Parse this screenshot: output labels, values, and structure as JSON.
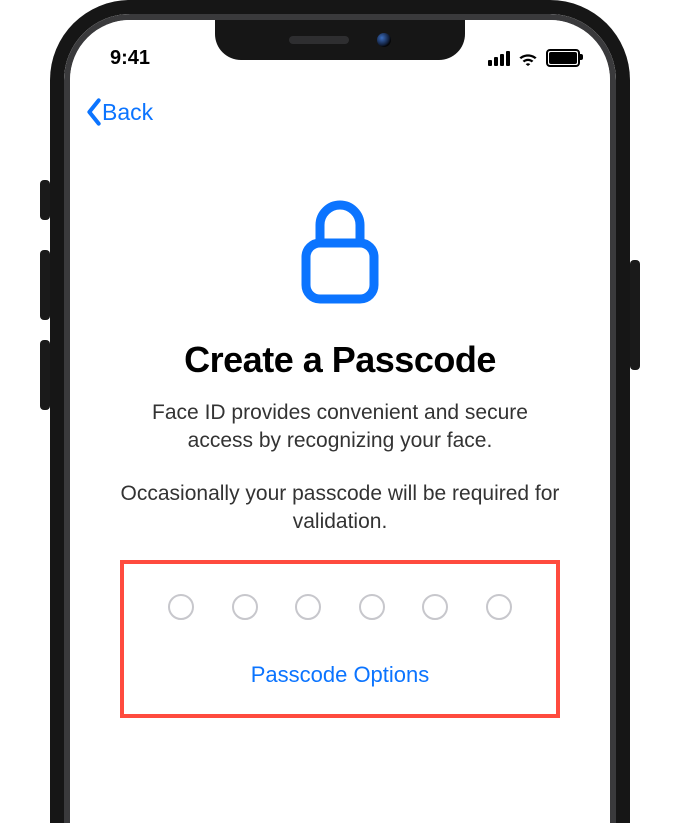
{
  "status": {
    "time": "9:41"
  },
  "nav": {
    "back_label": "Back"
  },
  "page": {
    "title": "Create a Passcode",
    "desc1": "Face ID provides convenient and secure access by recognizing your face.",
    "desc2": "Occasionally your passcode will be required for validation.",
    "options_label": "Passcode Options"
  },
  "colors": {
    "accent": "#0b74ff",
    "highlight": "#ff4b3e"
  }
}
